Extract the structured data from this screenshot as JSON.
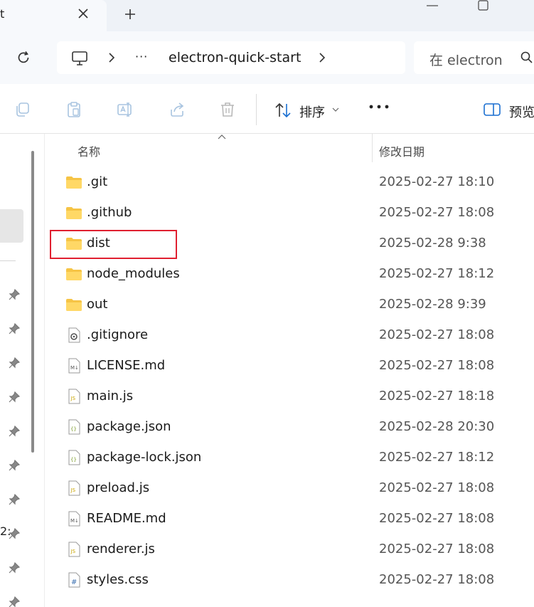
{
  "tab": {
    "title": "t",
    "close_icon": "close-icon",
    "new_tab_icon": "plus-icon"
  },
  "address_bar": {
    "refresh_icon": "refresh-icon",
    "location_icon": "this-pc-icon",
    "more_label": "···",
    "breadcrumb": "electron-quick-start",
    "search_placeholder": "在 electron"
  },
  "toolbar": {
    "copy_icon": "copy-icon",
    "paste_icon": "paste-icon",
    "rename_icon": "rename-icon",
    "share_icon": "share-icon",
    "delete_icon": "trash-icon",
    "sort_label": "排序",
    "more_icon": "more-icon",
    "preview_label": "预览"
  },
  "nav": {
    "fragment": "2:"
  },
  "columns": {
    "name": "名称",
    "date": "修改日期"
  },
  "files": [
    {
      "name": ".git",
      "date": "2025-02-27 18:10",
      "type": "folder"
    },
    {
      "name": ".github",
      "date": "2025-02-27 18:08",
      "type": "folder"
    },
    {
      "name": "dist",
      "date": "2025-02-28 9:38",
      "type": "folder"
    },
    {
      "name": "node_modules",
      "date": "2025-02-27 18:12",
      "type": "folder"
    },
    {
      "name": "out",
      "date": "2025-02-28 9:39",
      "type": "folder"
    },
    {
      "name": ".gitignore",
      "date": "2025-02-27 18:08",
      "type": "config"
    },
    {
      "name": "LICENSE.md",
      "date": "2025-02-27 18:08",
      "type": "markdown"
    },
    {
      "name": "main.js",
      "date": "2025-02-27 18:18",
      "type": "js"
    },
    {
      "name": "package.json",
      "date": "2025-02-28 20:30",
      "type": "json"
    },
    {
      "name": "package-lock.json",
      "date": "2025-02-27 18:12",
      "type": "json"
    },
    {
      "name": "preload.js",
      "date": "2025-02-27 18:08",
      "type": "js"
    },
    {
      "name": "README.md",
      "date": "2025-02-27 18:08",
      "type": "markdown"
    },
    {
      "name": "renderer.js",
      "date": "2025-02-27 18:08",
      "type": "js"
    },
    {
      "name": "styles.css",
      "date": "2025-02-27 18:08",
      "type": "css"
    }
  ],
  "colors": {
    "highlight": "#e02030",
    "folder": "#f6c445",
    "js_badge": "#c9a400",
    "json_badge": "#7a9a2a",
    "css_badge": "#3b6fb0"
  }
}
